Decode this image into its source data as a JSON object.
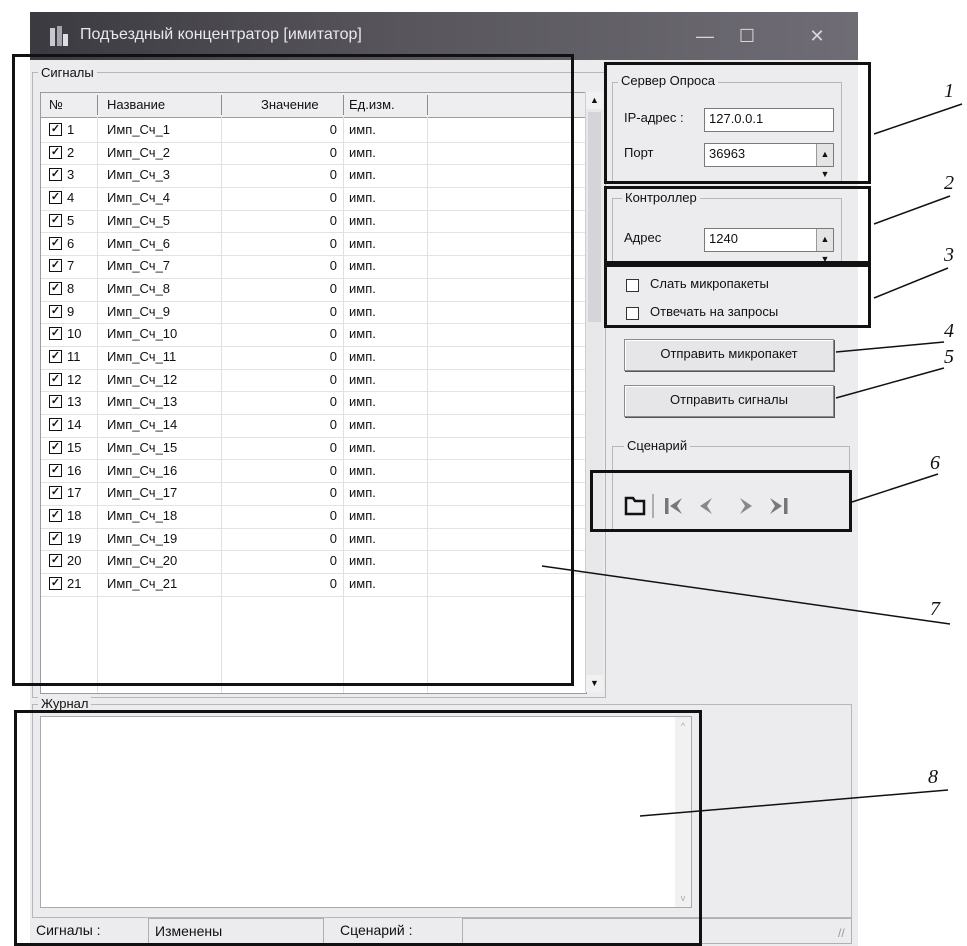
{
  "window": {
    "title": "Подъездный концентратор [имитатор]",
    "min": "—",
    "max": "☐",
    "close": "✕"
  },
  "signals": {
    "group_title": "Сигналы",
    "columns": [
      "№",
      "Название",
      "Значение",
      "Ед.изм."
    ],
    "rows": [
      {
        "num": "1",
        "name": "Имп_Сч_1",
        "value": "0",
        "unit": "имп."
      },
      {
        "num": "2",
        "name": "Имп_Сч_2",
        "value": "0",
        "unit": "имп."
      },
      {
        "num": "3",
        "name": "Имп_Сч_3",
        "value": "0",
        "unit": "имп."
      },
      {
        "num": "4",
        "name": "Имп_Сч_4",
        "value": "0",
        "unit": "имп."
      },
      {
        "num": "5",
        "name": "Имп_Сч_5",
        "value": "0",
        "unit": "имп."
      },
      {
        "num": "6",
        "name": "Имп_Сч_6",
        "value": "0",
        "unit": "имп."
      },
      {
        "num": "7",
        "name": "Имп_Сч_7",
        "value": "0",
        "unit": "имп."
      },
      {
        "num": "8",
        "name": "Имп_Сч_8",
        "value": "0",
        "unit": "имп."
      },
      {
        "num": "9",
        "name": "Имп_Сч_9",
        "value": "0",
        "unit": "имп."
      },
      {
        "num": "10",
        "name": "Имп_Сч_10",
        "value": "0",
        "unit": "имп."
      },
      {
        "num": "11",
        "name": "Имп_Сч_11",
        "value": "0",
        "unit": "имп."
      },
      {
        "num": "12",
        "name": "Имп_Сч_12",
        "value": "0",
        "unit": "имп."
      },
      {
        "num": "13",
        "name": "Имп_Сч_13",
        "value": "0",
        "unit": "имп."
      },
      {
        "num": "14",
        "name": "Имп_Сч_14",
        "value": "0",
        "unit": "имп."
      },
      {
        "num": "15",
        "name": "Имп_Сч_15",
        "value": "0",
        "unit": "имп."
      },
      {
        "num": "16",
        "name": "Имп_Сч_16",
        "value": "0",
        "unit": "имп."
      },
      {
        "num": "17",
        "name": "Имп_Сч_17",
        "value": "0",
        "unit": "имп."
      },
      {
        "num": "18",
        "name": "Имп_Сч_18",
        "value": "0",
        "unit": "имп."
      },
      {
        "num": "19",
        "name": "Имп_Сч_19",
        "value": "0",
        "unit": "имп."
      },
      {
        "num": "20",
        "name": "Имп_Сч_20",
        "value": "0",
        "unit": "имп."
      },
      {
        "num": "21",
        "name": "Имп_Сч_21",
        "value": "0",
        "unit": "имп."
      }
    ]
  },
  "server": {
    "group_title": "Сервер Опроса",
    "ip_label": "IP-адрес :",
    "ip_value": "127.0.0.1",
    "port_label": "Порт",
    "port_value": "36963"
  },
  "controller": {
    "group_title": "Контроллер",
    "address_label": "Адрес",
    "address_value": "1240"
  },
  "options": {
    "send_micropackets": "Слать микропакеты",
    "answer_requests": "Отвечать на запросы"
  },
  "buttons": {
    "send_micropacket": "Отправить микропакет",
    "send_signals": "Отправить сигналы"
  },
  "scenario": {
    "group_title": "Сценарий"
  },
  "journal": {
    "group_title": "Журнал"
  },
  "status": {
    "signals_label": "Сигналы :",
    "signals_value": "Изменены",
    "scenario_label": "Сценарий :",
    "scenario_value": ""
  },
  "callouts": [
    "1",
    "2",
    "3",
    "4",
    "5",
    "6",
    "7",
    "8"
  ]
}
